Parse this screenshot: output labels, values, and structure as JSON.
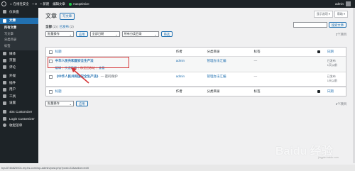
{
  "admin_bar": {
    "site_name": "在线社安全",
    "comments_count": "0",
    "new_label": "+ 新建",
    "edit_label": "编辑文章",
    "plugin_label": "Autoptimize",
    "user_label": "admin"
  },
  "sidebar": {
    "items": [
      {
        "label": "仪表盘",
        "active": false
      },
      {
        "label": "文章",
        "active": true
      },
      {
        "label": "媒体",
        "active": false
      },
      {
        "label": "页面",
        "active": false
      },
      {
        "label": "评论",
        "active": false
      },
      {
        "label": "外观",
        "active": false
      },
      {
        "label": "插件",
        "active": false
      },
      {
        "label": "用户",
        "active": false
      },
      {
        "label": "工具",
        "active": false
      },
      {
        "label": "设置",
        "active": false
      },
      {
        "label": "404 Customizer",
        "active": false
      },
      {
        "label": "Login Customizer",
        "active": false
      },
      {
        "label": "收起菜单",
        "active": false
      }
    ],
    "sub_items": [
      "所有文章",
      "写文章",
      "分类目录",
      "标签"
    ]
  },
  "page": {
    "title": "文章",
    "add_new": "写文章",
    "screen_options": "显示选项 ▾",
    "help": "帮助 ▾"
  },
  "filters": {
    "all": "全部",
    "all_count": "(2)",
    "sep": "|",
    "published": "已发布",
    "published_count": "(2)"
  },
  "search": {
    "placeholder": "",
    "button": "搜索文章"
  },
  "toolbar_top": {
    "bulk": "批量操作",
    "apply": "应用",
    "dates": "全部日期",
    "cats": "所有分类目录",
    "filter": "筛选",
    "count": "2个项目"
  },
  "table": {
    "headers": {
      "title": "标题",
      "author": "作者",
      "categories": "分类目录",
      "tags": "标签",
      "date": "日期"
    },
    "rows": [
      {
        "title": "中华人民共和国安全生产法",
        "suffix": "",
        "author": "admin",
        "categories": "管理办法汇编",
        "tags": "—",
        "date_status": "已发布",
        "date_value": "1天以前",
        "actions": [
          "编辑",
          "快速编辑",
          "移至回收站",
          "查看"
        ]
      },
      {
        "title": "《中华人民共和国安全生产法》",
        "suffix": " — 密码保护",
        "author": "admin",
        "categories": "管理办法汇编",
        "tags": "—",
        "date_status": "已发布",
        "date_value": "1天以前",
        "actions": []
      }
    ]
  },
  "toolbar_bottom": {
    "bulk": "批量操作",
    "apply": "应用",
    "count": "2个项目"
  },
  "status_url": "bpu3746820001.my.hs.com/wp-admin/post.php?post=22&action=edit",
  "watermark": {
    "text": "Baidu 经验",
    "sub": "jingyan.baidu.com"
  }
}
